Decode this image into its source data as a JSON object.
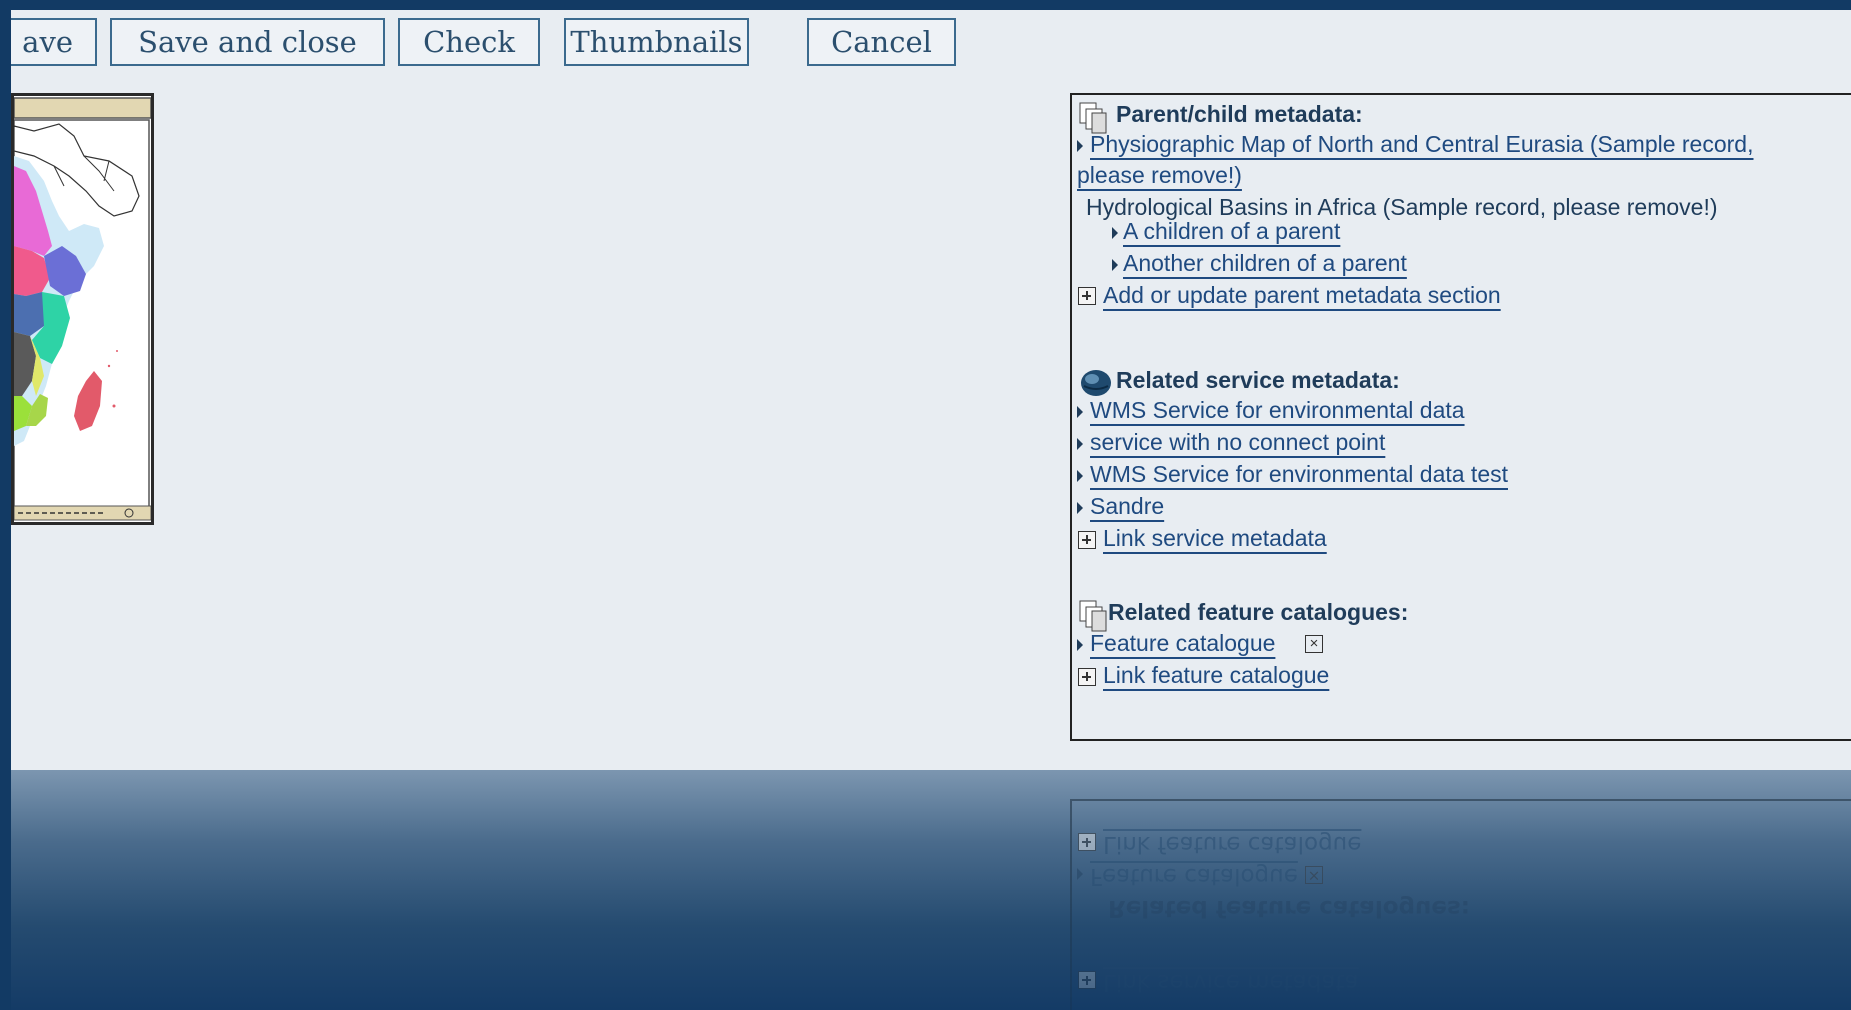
{
  "toolbar": {
    "buttons": [
      {
        "label": "ave",
        "name": "save-button"
      },
      {
        "label": "Save and close",
        "name": "save-and-close-button"
      },
      {
        "label": "Check",
        "name": "check-button"
      },
      {
        "label": "Thumbnails",
        "name": "thumbnails-button"
      },
      {
        "label": "Cancel",
        "name": "cancel-button"
      }
    ]
  },
  "thumbnail": {
    "icon": "map-thumbnail-africa"
  },
  "relations": {
    "parent_child": {
      "title": "Parent/child metadata:",
      "icon": "documents-icon",
      "parent_link": "Physiographic Map of North and Central Eurasia (Sample record, please remove!)",
      "parent_link_line1": "Physiographic Map of North and Central Eurasia (Sample record,",
      "parent_link_line2": "please remove!)",
      "current": "Hydrological Basins in Africa (Sample record, please remove!)",
      "children": [
        "A children of a parent",
        "Another children of a parent"
      ],
      "add_action": "Add or update parent metadata section"
    },
    "services": {
      "title": "Related service metadata:",
      "icon": "globe-icon",
      "items": [
        "WMS Service for environmental data",
        "service with no connect point",
        "WMS Service for environmental data test",
        "Sandre"
      ],
      "add_action": "Link service metadata"
    },
    "feature_catalogues": {
      "title": "Related feature catalogues:",
      "icon": "documents-icon",
      "items": [
        "Feature catalogue"
      ],
      "add_action": "Link feature catalogue"
    }
  },
  "colors": {
    "page_bg": "#e8edf2",
    "frame_bg": "#123a64",
    "link": "#1f4a80",
    "title": "#1f3c5a"
  }
}
